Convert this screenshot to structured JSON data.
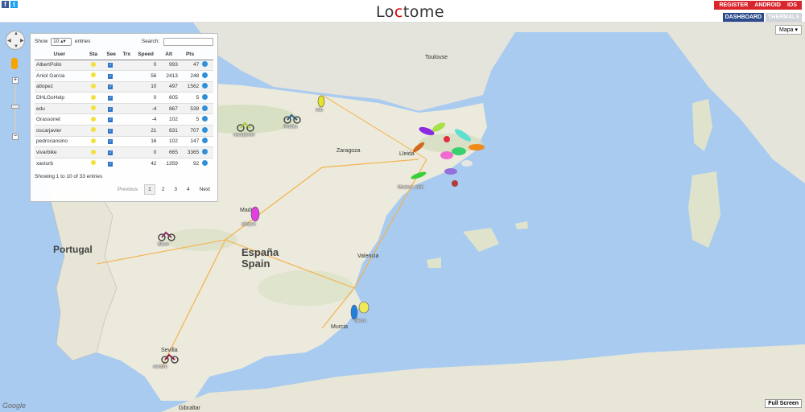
{
  "topbar": {
    "social": [
      "f",
      "t"
    ],
    "logo": {
      "left": "Lo",
      "mid": "c",
      "right": "tome"
    },
    "nav": [
      "REGISTER",
      "ANDROID",
      "IOS"
    ],
    "subnav": [
      "DASHBOARD",
      "THERMALS"
    ]
  },
  "map": {
    "type_select": "Mapa",
    "fullscreen": "Full Screen",
    "google": "Google",
    "countries": [
      {
        "name": "Portugal"
      },
      {
        "name": "España"
      },
      {
        "name": "Spain"
      }
    ],
    "cities": [
      "Toulouse",
      "Zaragoza",
      "Valencia",
      "Murcia",
      "Sevilla",
      "Gibraltar",
      "Lleida",
      "Madrid"
    ]
  },
  "panel": {
    "show_label": "Show",
    "show_value": "10",
    "entries_label": "entries",
    "search_label": "Search:",
    "columns": [
      "User",
      "Sta",
      "See",
      "Trx",
      "Speed",
      "Alt",
      "Pts"
    ],
    "rows": [
      {
        "user": "AlbertPollo",
        "speed": "0",
        "alt": "993",
        "pts": "47"
      },
      {
        "user": "Aniol Garcia",
        "speed": "56",
        "alt": "2413",
        "pts": "248"
      },
      {
        "user": "atlopez",
        "speed": "10",
        "alt": "497",
        "pts": "1562"
      },
      {
        "user": "DHLGoHelp",
        "speed": "0",
        "alt": "605",
        "pts": "5"
      },
      {
        "user": "edu",
        "speed": "-4",
        "alt": "867",
        "pts": "539"
      },
      {
        "user": "Grassonet",
        "speed": "-4",
        "alt": "102",
        "pts": "5"
      },
      {
        "user": "oscarjavier",
        "speed": "21",
        "alt": "831",
        "pts": "707"
      },
      {
        "user": "pedrocansino",
        "speed": "16",
        "alt": "102",
        "pts": "147"
      },
      {
        "user": "vivarbike",
        "speed": "0",
        "alt": "665",
        "pts": "3365"
      },
      {
        "user": "xaviurb",
        "speed": "42",
        "alt": "1359",
        "pts": "92"
      }
    ],
    "info": "Showing 1 to 10 of 33 entries",
    "pager": {
      "prev": "Previous",
      "pages": [
        "1",
        "2",
        "3",
        "4"
      ],
      "next": "Next",
      "active": "1"
    }
  },
  "markers": [
    {
      "label": "oscarjavier",
      "color": "#a3c93a"
    },
    {
      "label": "Pedrito",
      "color": "#2d5c8a"
    },
    {
      "label": "edu",
      "color": "#e3e32a"
    },
    {
      "label": "atlopez",
      "color": "#e040e0"
    },
    {
      "label": "Bikee",
      "color": "#8b2a6b"
    },
    {
      "label": "xaviurb",
      "color": "#8b1a4a"
    },
    {
      "label": "Sierra",
      "color": "#2080e0"
    },
    {
      "label": "Masterc Veld",
      "color": "#38d038"
    }
  ]
}
